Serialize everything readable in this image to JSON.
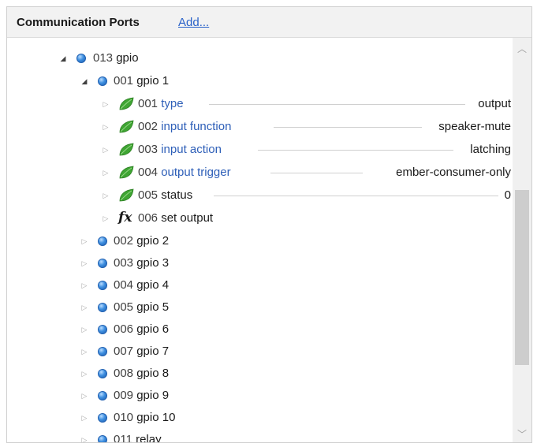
{
  "header": {
    "title": "Communication Ports",
    "add_label": "Add..."
  },
  "tree": {
    "gpio": {
      "num": "013",
      "name": "gpio"
    },
    "gpio1": {
      "num": "001",
      "name": "gpio 1"
    },
    "params": [
      {
        "num": "001",
        "name": "type",
        "value": "output"
      },
      {
        "num": "002",
        "name": "input function",
        "value": "speaker-mute"
      },
      {
        "num": "003",
        "name": "input action",
        "value": "latching"
      },
      {
        "num": "004",
        "name": "output trigger",
        "value": "ember-consumer-only"
      },
      {
        "num": "005",
        "name": "status",
        "value": "0"
      }
    ],
    "function": {
      "num": "006",
      "name": "set output",
      "icon": "fx-icon"
    },
    "nodes": [
      {
        "num": "002",
        "name": "gpio 2"
      },
      {
        "num": "003",
        "name": "gpio 3"
      },
      {
        "num": "004",
        "name": "gpio 4"
      },
      {
        "num": "005",
        "name": "gpio 5"
      },
      {
        "num": "006",
        "name": "gpio 6"
      },
      {
        "num": "007",
        "name": "gpio 7"
      },
      {
        "num": "008",
        "name": "gpio 8"
      },
      {
        "num": "009",
        "name": "gpio 9"
      },
      {
        "num": "010",
        "name": "gpio 10"
      },
      {
        "num": "011",
        "name": "relay"
      }
    ]
  },
  "icons": {
    "node": "blue-ball-icon",
    "parameter": "green-leaf-icon",
    "expanded": "triangle-down-icon",
    "collapsed": "triangle-right-icon"
  },
  "colors": {
    "parameter_name": "#2e5fb8",
    "link": "#2a62c9",
    "node_ball": "#3e8fe0",
    "leaf": "#3fa533"
  }
}
